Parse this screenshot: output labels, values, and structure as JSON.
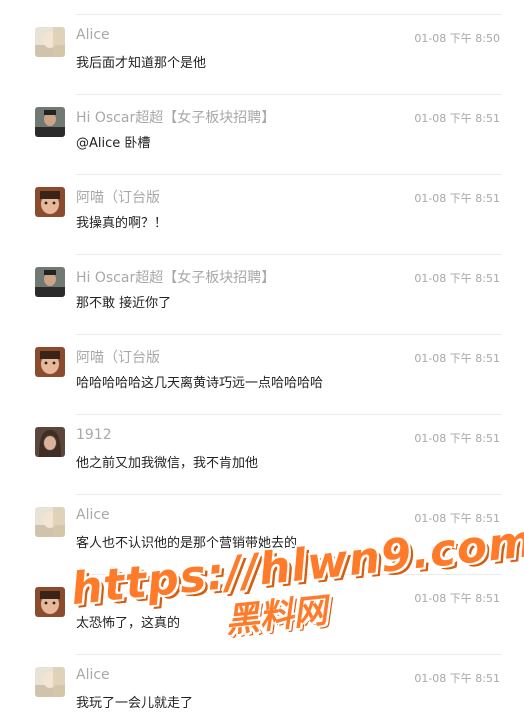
{
  "comments": [
    {
      "name": "Alice",
      "time": "01-08 下午 8:50",
      "text": "我后面才知道那个是他",
      "avatar": "alice-avatar"
    },
    {
      "name": "Hi Oscar超超【女子板块招聘】",
      "time": "01-08 下午 8:51",
      "text": "@Alice 卧槽",
      "avatar": "oscar-avatar"
    },
    {
      "name": "阿喵（订台版",
      "time": "01-08 下午 8:51",
      "text": "我操真的啊？！",
      "avatar": "amiao-avatar"
    },
    {
      "name": "Hi Oscar超超【女子板块招聘】",
      "time": "01-08 下午 8:51",
      "text": "那不敢 接近你了",
      "avatar": "oscar-avatar"
    },
    {
      "name": "阿喵（订台版",
      "time": "01-08 下午 8:51",
      "text": "哈哈哈哈哈这几天离黄诗巧远一点哈哈哈哈",
      "avatar": "amiao-avatar"
    },
    {
      "name": "1912",
      "time": "01-08 下午 8:51",
      "text": "他之前又加我微信，我不肯加他",
      "avatar": "1912-avatar"
    },
    {
      "name": "Alice",
      "time": "01-08 下午 8:51",
      "text": "客人也不认识他的是那个营销带她去的",
      "avatar": "alice-avatar"
    },
    {
      "name": "",
      "time": "01-08 下午 8:51",
      "text": "太恐怖了，这真的",
      "avatar": "amiao-avatar"
    },
    {
      "name": "Alice",
      "time": "01-08 下午 8:51",
      "text": "我玩了一会儿就走了",
      "avatar": "alice-avatar"
    }
  ],
  "watermark": {
    "url": "https://hlwn9.com",
    "label": "黑料网",
    "color": "#ff7b2a"
  }
}
